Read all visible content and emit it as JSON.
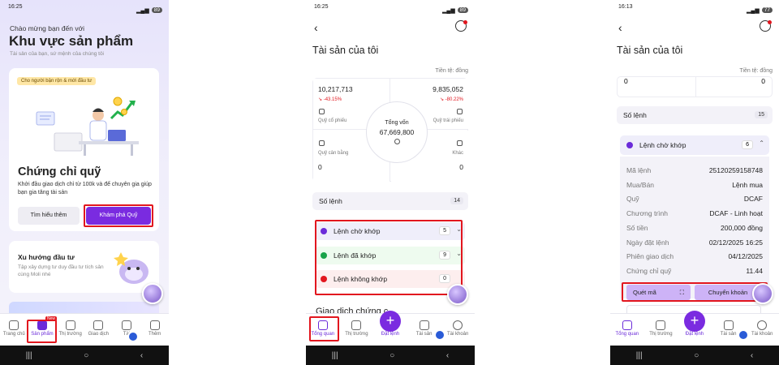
{
  "screens": [
    {
      "status": {
        "time": "16:25",
        "battery": "89"
      },
      "greeting": "Chào mừng bạn đến với",
      "title": "Khu vực sản phẩm",
      "subtitle": "Tài sản của bạn, sứ mệnh của chúng tôi",
      "chip": "Cho người bận rộn & mới đầu tư",
      "product_title": "Chứng chỉ quỹ",
      "product_desc": "Khởi đầu giao dịch chỉ từ 100k và để chuyên gia giúp bạn gia tăng tài sản",
      "learn_more": "Tìm hiểu thêm",
      "explore": "Khám phá Quỹ",
      "trend_title": "Xu hướng đầu tư",
      "trend_desc": "Tập xây dựng tư duy đầu tư tích sản cùng Moli nhé",
      "tabs": [
        "Trang chủ",
        "Sản phẩm",
        "Thị trường",
        "Giao dịch",
        "Tài",
        "Thêm"
      ],
      "new_badge": "New"
    },
    {
      "status": {
        "time": "16:25",
        "battery": "89"
      },
      "title": "Tài sản của tôi",
      "currency": "Tiền tệ: đồng",
      "quads": [
        {
          "value": "10,217,713",
          "pct": "-43.15%",
          "label": "Quỹ cổ phiếu"
        },
        {
          "value": "9,835,052",
          "pct": "-80.22%",
          "label": "Quỹ trái phiếu"
        },
        {
          "value": "0",
          "label": "Quỹ cân bằng"
        },
        {
          "value": "0",
          "label": "Khác"
        }
      ],
      "total_label": "Tổng vốn",
      "total_value": "67,669,800",
      "orders_label": "Số lệnh",
      "orders_count": "14",
      "order_rows": [
        {
          "label": "Lệnh chờ khớp",
          "count": "5"
        },
        {
          "label": "Lệnh đã khớp",
          "count": "9"
        },
        {
          "label": "Lệnh không khớp",
          "count": "0"
        }
      ],
      "peek": "Giao dịch chứng c",
      "tabs": [
        "Tổng quan",
        "Thị trường",
        "Đặt lệnh",
        "Tài sản",
        "Tài khoản"
      ]
    },
    {
      "status": {
        "time": "16:13",
        "battery": "77"
      },
      "title": "Tài sản của tôi",
      "currency": "Tiền tệ: đồng",
      "zeros": [
        "0",
        "0"
      ],
      "orders_label": "Số lệnh",
      "orders_count": "15",
      "pending_label": "Lệnh chờ khớp",
      "pending_count": "6",
      "details": [
        {
          "label": "Mã lệnh",
          "value": "25120259158748"
        },
        {
          "label": "Mua/Bán",
          "value": "Lệnh mua"
        },
        {
          "label": "Quỹ",
          "value": "DCAF"
        },
        {
          "label": "Chương trình",
          "value": "DCAF - Linh hoạt"
        },
        {
          "label": "Số tiền",
          "value": "200,000 đồng"
        },
        {
          "label": "Ngày đặt lệnh",
          "value": "02/12/2025 16:25"
        },
        {
          "label": "Phiên giao dịch",
          "value": "04/12/2025"
        },
        {
          "label": "Chứng chỉ quỹ",
          "value": "11.44"
        }
      ],
      "scan": "Quét mã",
      "transfer": "Chuyển khoản",
      "tabs": [
        "Tổng quan",
        "Thị trường",
        "Đặt lệnh",
        "Tài sản",
        "Tài khoản"
      ]
    }
  ],
  "colors": {
    "brand": "#7a2be0",
    "highlight": "#e2161e",
    "positive": "#1aa34a",
    "negative": "#e2161e"
  }
}
